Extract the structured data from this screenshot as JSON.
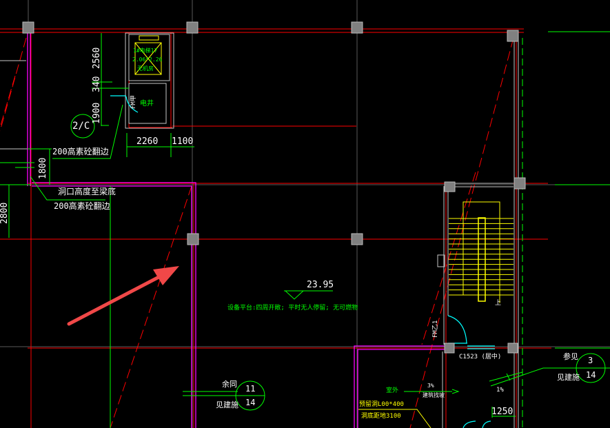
{
  "drawing": {
    "colors": {
      "background": "#000000",
      "axis": "#ff0000",
      "wall": "#c0c0c0",
      "annotation": "#00ff00",
      "stair": "#ffff00",
      "door": "#00ffff",
      "boundary": "#ff00ff",
      "arrow": "#ff4040"
    },
    "dimensions": {
      "d2560": "2560",
      "d1900": "1900",
      "d340": "340",
      "d2260": "2260",
      "d1100": "1100",
      "d1800": "1800",
      "d2800": "2800",
      "d1250": "1250"
    },
    "grid_bubble": "2/C",
    "elevator": {
      "line1": "1#电梯17",
      "line2": "2.06*2.26",
      "line3": "无机房"
    },
    "shaft_label": "电井",
    "fire_door_1": "FM甲",
    "fire_door_2": "FM乙1",
    "notes": {
      "curb_200_top": "200高素砼翻边",
      "opening_height": "洞口高度至梁底",
      "curb_200_bottom": "200高素砼翻边",
      "elevation": "23.95",
      "platform": "设备平台:四周开敞; 平时无人停留; 无可燃物",
      "window": "C1523 (居中)",
      "outdoor": "室外",
      "slope_3": "3%",
      "slope_3_desc": "建筑找坡",
      "slope_1": "1%",
      "sill": "预留洞L00*400",
      "sill_height": "洞底距地3100"
    },
    "detail_refs": [
      {
        "top_text": "余同",
        "bottom_text": "见建施",
        "number": "11",
        "sheet": "14"
      },
      {
        "top_text": "参见",
        "bottom_text": "见建施",
        "number": "3",
        "sheet": "14"
      }
    ],
    "stair_up_mark": "上"
  }
}
